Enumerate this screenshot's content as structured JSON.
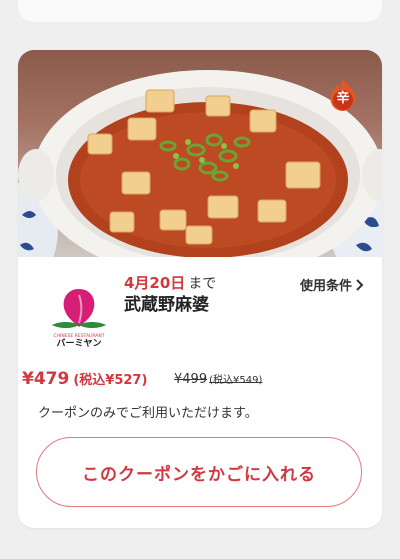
{
  "coupon": {
    "badge_label": "辛",
    "logo": {
      "sub_text": "CHINESE RESTAURANT",
      "brand_text": "バーミヤン"
    },
    "expiry_date": "4月20日",
    "expiry_suffix": "まで",
    "conditions_label": "使用条件",
    "product_name": "武蔵野麻婆",
    "price": "¥479",
    "price_tax": "(税込¥527)",
    "old_price": "¥499",
    "old_price_tax": "(税込¥549)",
    "note": "クーポンのみでご利用いただけます。",
    "cart_button_label": "このクーポンをかごに入れる"
  },
  "colors": {
    "accent_red": "#d2383f",
    "button_border": "#e07a7f",
    "badge_orange": "#e8561f",
    "logo_pink": "#d61f74",
    "logo_green": "#2e8b3a"
  },
  "icons": [
    "flame-icon",
    "chevron-right-icon",
    "peach-logo-icon"
  ]
}
